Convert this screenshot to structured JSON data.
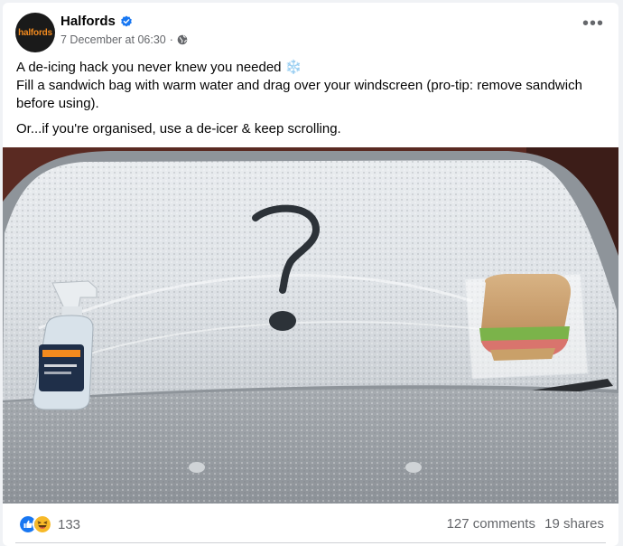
{
  "post": {
    "page_name": "Halfords",
    "avatar_text": "halfords",
    "timestamp": "7 December at 06:30",
    "dot": "·",
    "more_label": "•••",
    "text_line1": "A de-icing hack you never knew you needed",
    "snow_glyph": "❄️",
    "text_line2": "Fill a sandwich bag with warm water and drag over your windscreen (pro-tip: remove sandwich before using).",
    "text_line3": "Or...if you're organised, use a de-icer & keep scrolling."
  },
  "engagement": {
    "reaction_count": "133",
    "comments": "127 comments",
    "shares": "19 shares"
  },
  "colors": {
    "brand_orange": "#f28a1e",
    "facebook_blue": "#1877f2",
    "haha_yellow": "#f7b928",
    "meta_grey": "#65676b"
  },
  "icons": [
    "verified-badge-icon",
    "globe-icon",
    "more-options-icon",
    "like-reaction-icon",
    "haha-reaction-icon"
  ]
}
